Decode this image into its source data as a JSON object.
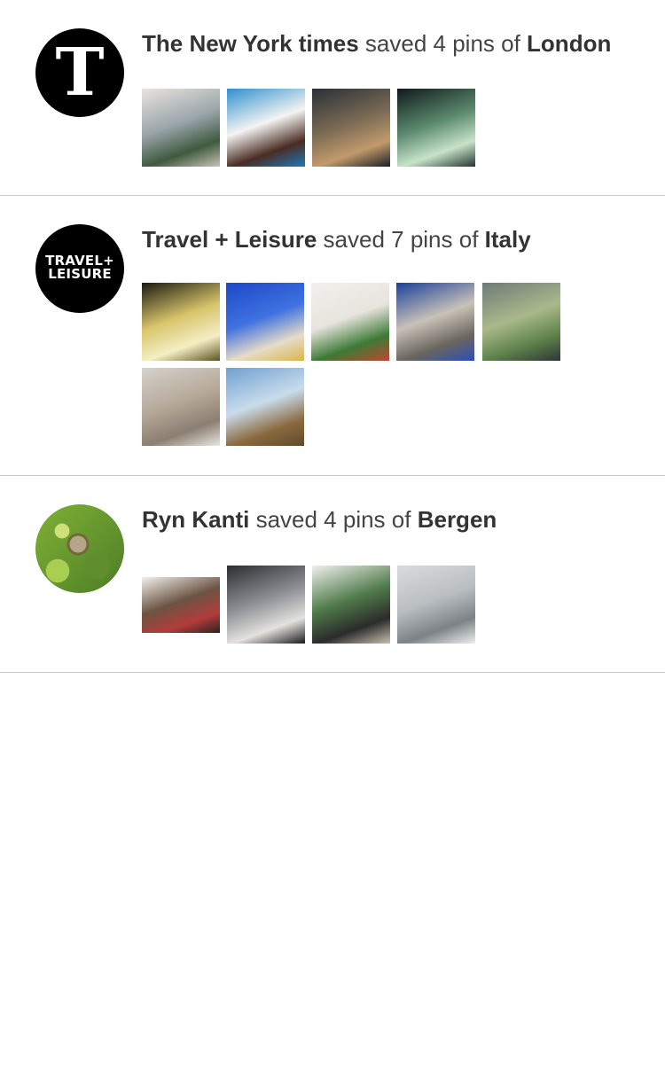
{
  "feed": [
    {
      "user": "The New York times",
      "action": "saved 4 pins of",
      "board": "London",
      "avatar_icon": "nyt-logo-icon",
      "logo_text": "T",
      "thumbs": [
        {
          "name": "paris-street-thumb",
          "colors": [
            "#e9e4dd",
            "#9aa5ab",
            "#3f5a3e",
            "#c9c1b6"
          ]
        },
        {
          "name": "milk-cookies-thumb",
          "colors": [
            "#2e90cf",
            "#f4f4f2",
            "#4a2c22",
            "#1f78b8"
          ]
        },
        {
          "name": "dancer-thumb",
          "colors": [
            "#2a2f36",
            "#7a6a55",
            "#c29a6b",
            "#1a1e24"
          ]
        },
        {
          "name": "aurora-thumb",
          "colors": [
            "#0f1a1a",
            "#5b8a6e",
            "#c7e3c9",
            "#243530"
          ]
        }
      ]
    },
    {
      "user": "Travel + Leisure",
      "action": "saved 7 pins of",
      "board": "Italy",
      "avatar_icon": "travel-leisure-logo-icon",
      "logo_line1": "TRAVEL+",
      "logo_line2": "LEISURE",
      "thumbs": [
        {
          "name": "gold-installation-thumb",
          "colors": [
            "#1a1a12",
            "#d8c46a",
            "#f4eec4",
            "#5b5321"
          ]
        },
        {
          "name": "beach-boardwalk-thumb",
          "colors": [
            "#1d47c9",
            "#3f72e0",
            "#e6dcc8",
            "#d8b64a"
          ]
        },
        {
          "name": "window-plants-thumb",
          "colors": [
            "#f2f0ec",
            "#e8e4de",
            "#3d7a36",
            "#c0462f"
          ]
        },
        {
          "name": "curved-building-thumb",
          "colors": [
            "#1b3f9a",
            "#c8c2b8",
            "#6a655e",
            "#2a4fb8"
          ]
        },
        {
          "name": "window-forest-thumb",
          "colors": [
            "#6e7a78",
            "#a9b98a",
            "#5c7f4a",
            "#2e3634"
          ]
        },
        {
          "name": "stone-street-thumb",
          "colors": [
            "#d6d2cc",
            "#b5a898",
            "#8b7f72",
            "#e9e6e1"
          ]
        },
        {
          "name": "canyon-sky-thumb",
          "colors": [
            "#6fa0d2",
            "#c9dceb",
            "#8a6a3f",
            "#5e4a2c"
          ]
        }
      ]
    },
    {
      "user": "Ryn Kanti",
      "action": "saved 4 pins of",
      "board": "Bergen",
      "avatar_icon": "leaf-stone-avatar-icon",
      "thumbs": [
        {
          "name": "shop-interior-thumb",
          "colors": [
            "#f3f1ed",
            "#6c5443",
            "#b23c3a",
            "#2a2320"
          ]
        },
        {
          "name": "black-building-thumb",
          "colors": [
            "#2c2d30",
            "#8d9096",
            "#e4e2de",
            "#1a1b1d"
          ]
        },
        {
          "name": "cafe-person-thumb",
          "colors": [
            "#f1f0ed",
            "#4f7a4a",
            "#2b2b2b",
            "#c8bfae"
          ]
        },
        {
          "name": "foggy-canal-thumb",
          "colors": [
            "#d9dcdd",
            "#b9bec1",
            "#7c8286",
            "#eeefef"
          ]
        }
      ]
    }
  ]
}
